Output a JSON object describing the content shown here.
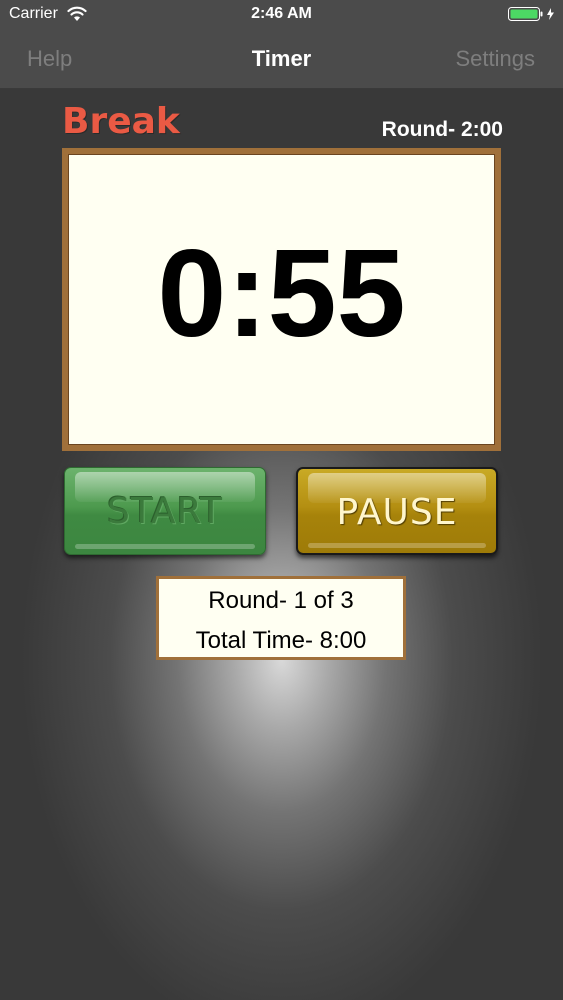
{
  "status_bar": {
    "carrier": "Carrier",
    "time": "2:46 AM",
    "icons": [
      "wifi-icon",
      "battery-icon",
      "charging-bolt-icon"
    ]
  },
  "nav": {
    "left_label": "Help",
    "title": "Timer",
    "right_label": "Settings"
  },
  "timer": {
    "mode_label": "Break",
    "round_duration": "Round- 2:00",
    "display": "0:55"
  },
  "controls": {
    "start_label": "START",
    "pause_label": "PAUSE"
  },
  "info": {
    "round": "Round- 1 of 3",
    "total_time": "Total Time- 8:00"
  },
  "colors": {
    "mode_label": "#ea5a44",
    "start_button": "#4d9a4e",
    "pause_button": "#b48f12",
    "frame": "#a0703a",
    "display_background": "#fffff2"
  }
}
